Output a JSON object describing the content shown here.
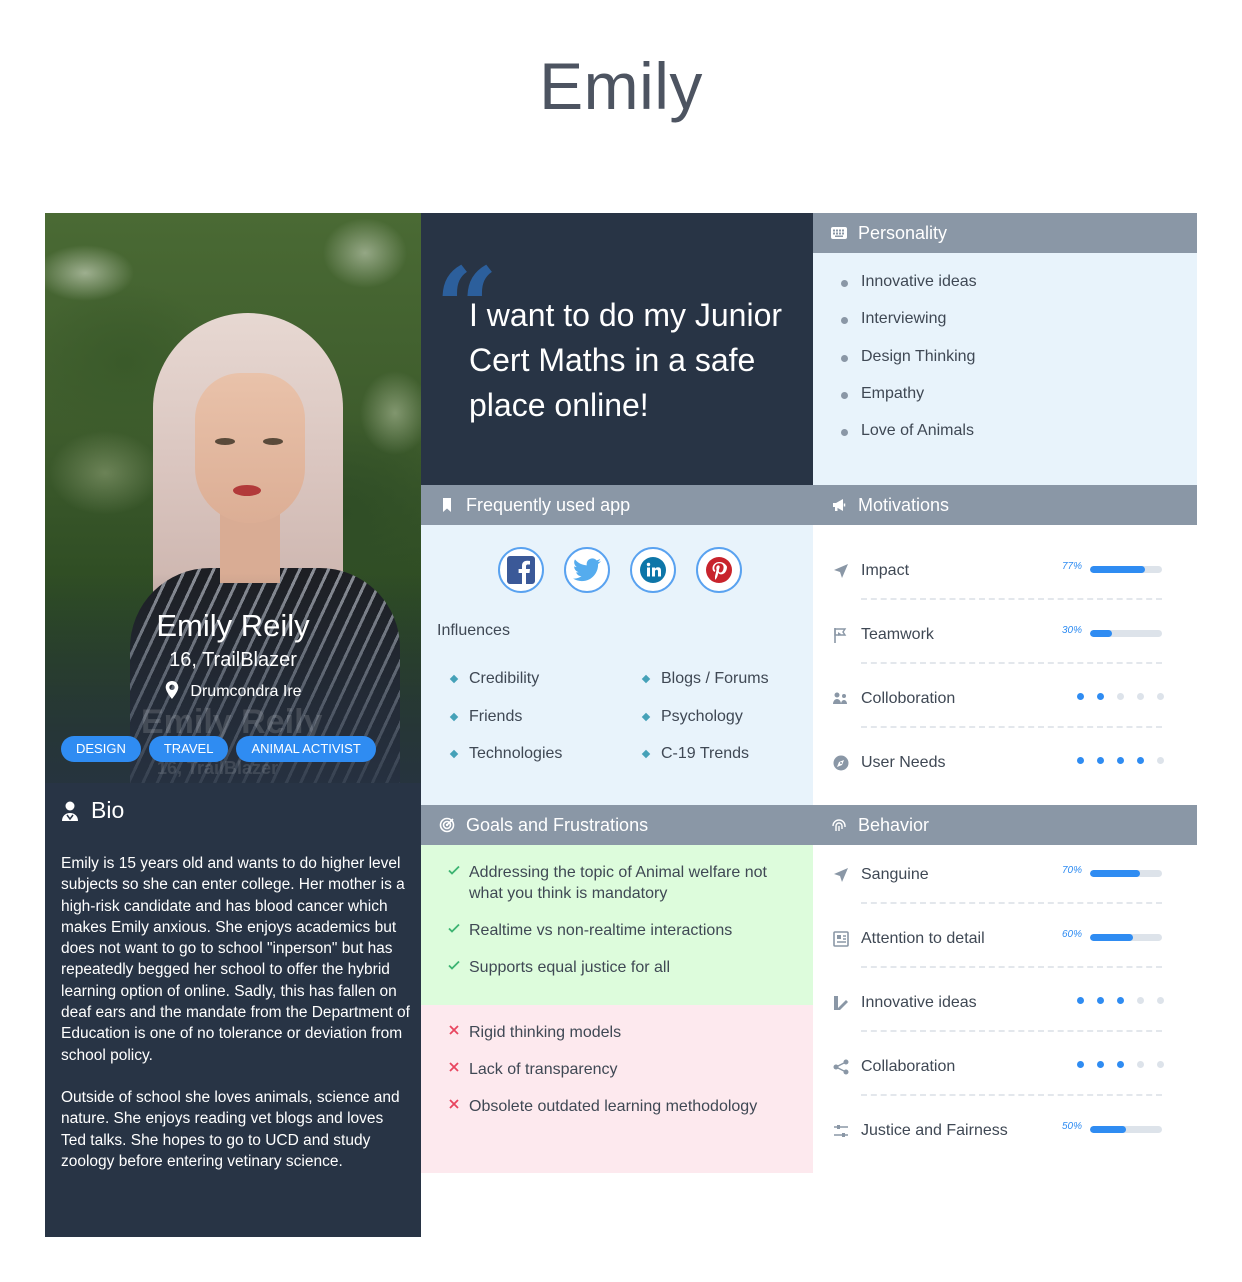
{
  "page": {
    "title": "Emily"
  },
  "profile": {
    "name": "Emily Reily",
    "subtitle": "16, TrailBlazer",
    "location": "Drumcondra Ire",
    "tags": [
      "Design",
      "Travel",
      "Animal Activist"
    ]
  },
  "bio": {
    "heading": "Bio",
    "paragraph1": "Emily is 15 years old and wants to do higher level subjects so she can enter college. Her mother is a high-risk candidate and has blood cancer which makes Emily anxious. She enjoys academics but does not want to go to school \"inperson\" but has repeatedly begged her school to offer the hybrid learning option of online. Sadly, this has fallen on deaf ears and the mandate from the Department of Education is one of no tolerance or deviation from school policy.",
    "paragraph2": "Outside of school she loves animals, science and nature. She enjoys reading vet blogs and loves Ted talks. She hopes to go to UCD and study zoology before entering vetinary science."
  },
  "quote": {
    "text": "I want to do my Junior Cert Maths in a safe place online!"
  },
  "personality": {
    "title": "Personality",
    "items": [
      "Innovative ideas",
      "Interviewing",
      "Design Thinking",
      "Empathy",
      "Love of Animals"
    ]
  },
  "apps": {
    "title": "Frequently used app",
    "icons": [
      "facebook-icon",
      "twitter-icon",
      "linkedin-icon",
      "pinterest-icon"
    ],
    "influences_label": "Influences",
    "influences_left": [
      "Credibility",
      "Friends",
      "Technologies"
    ],
    "influences_right": [
      "Blogs / Forums",
      "Psychology",
      "C-19 Trends"
    ]
  },
  "motivations": {
    "title": "Motivations",
    "items": [
      {
        "label": "Impact",
        "kind": "bar",
        "percent_label": "77%",
        "value": 77,
        "icon": "navigation-icon"
      },
      {
        "label": "Teamwork",
        "kind": "bar",
        "percent_label": "30%",
        "value": 30,
        "icon": "flags-icon"
      },
      {
        "label": "Colloboration",
        "kind": "dots",
        "value": 2,
        "icon": "people-icon"
      },
      {
        "label": "User Needs",
        "kind": "dots",
        "value": 4,
        "icon": "compass-icon"
      }
    ]
  },
  "goals": {
    "title": "Goals and Frustrations",
    "goals": [
      "Addressing the topic of Animal welfare not what you think is mandatory",
      "Realtime vs non-realtime interactions",
      "Supports equal justice for all"
    ],
    "frustrations": [
      "Rigid thinking models",
      "Lack of transparency",
      "Obsolete outdated learning methodology"
    ]
  },
  "behavior": {
    "title": "Behavior",
    "items": [
      {
        "label": "Sanguine",
        "kind": "bar",
        "percent_label": "70%",
        "value": 70,
        "icon": "navigation-icon"
      },
      {
        "label": "Attention to detail",
        "kind": "bar",
        "percent_label": "60%",
        "value": 60,
        "icon": "newspaper-icon"
      },
      {
        "label": "Innovative ideas",
        "kind": "dots",
        "value": 3,
        "icon": "pencil-ruler-icon"
      },
      {
        "label": "Collaboration",
        "kind": "dots",
        "value": 3,
        "icon": "share-icon"
      },
      {
        "label": "Justice and Fairness",
        "kind": "bar",
        "percent_label": "50%",
        "value": 50,
        "icon": "sliders-icon"
      }
    ]
  },
  "colors": {
    "accent": "#2f8cf2",
    "header": "#8a97a6",
    "dark": "#283445"
  }
}
